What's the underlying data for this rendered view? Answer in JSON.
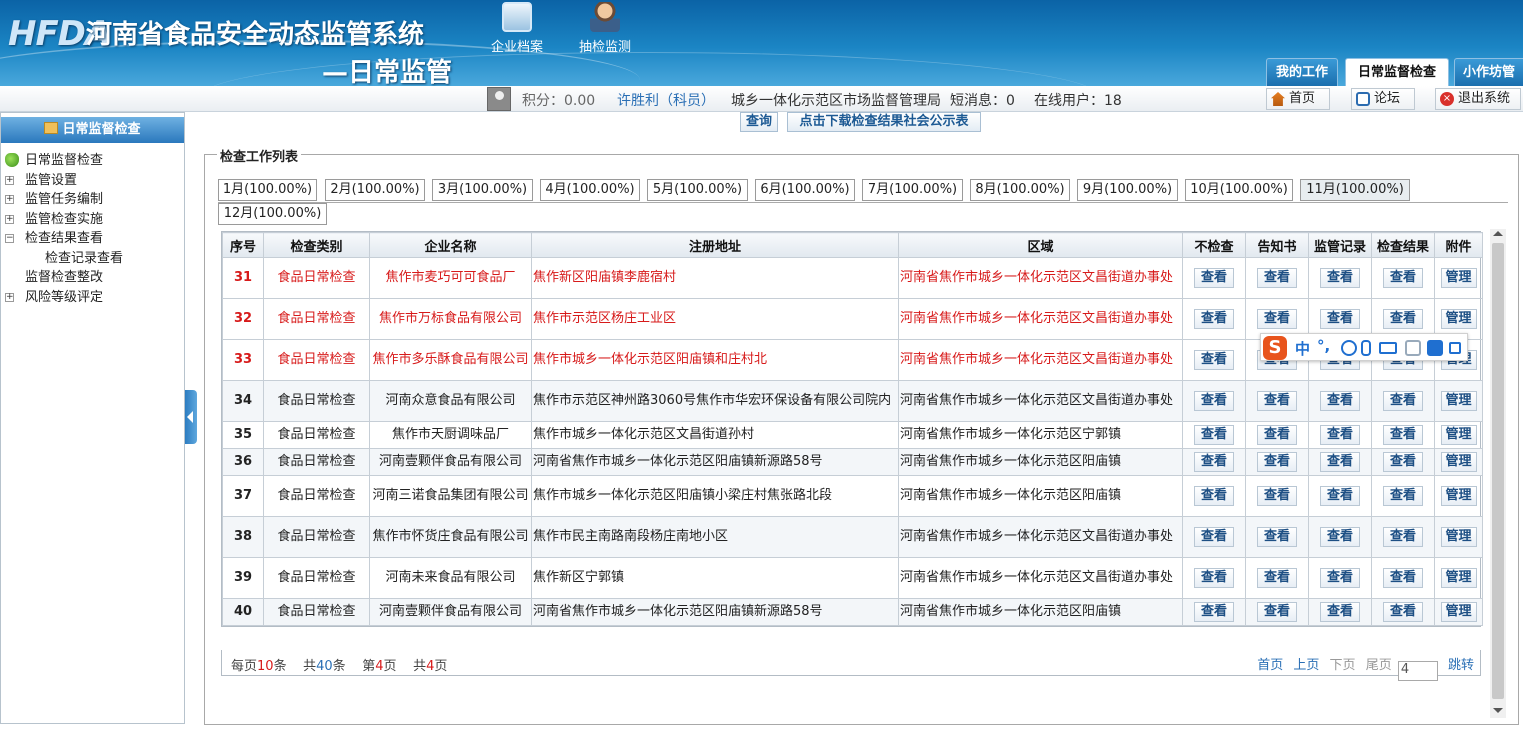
{
  "header": {
    "logo": "HFDA",
    "title_line1": "河南省食品安全动态监管系统",
    "title_line2": "—日常监管",
    "nav": [
      {
        "label": "企业档案"
      },
      {
        "label": "抽检监测"
      }
    ],
    "tabs": [
      "我的工作",
      "日常监督检查",
      "小作坊管理"
    ]
  },
  "infobar": {
    "score": "积分：0.00",
    "user": "许胜利（科员）",
    "org": "城乡一体化示范区市场监督管理局",
    "messages": "短消息：0",
    "online": "在线用户：18",
    "buttons": [
      "首页",
      "论坛",
      "退出系统"
    ]
  },
  "sidebar": {
    "title": "日常监督检查",
    "items": [
      {
        "label": "日常监督检查",
        "icon": "tree-root-icon"
      },
      {
        "label": "监管设置",
        "toggle": "+"
      },
      {
        "label": "监管任务编制",
        "toggle": "+"
      },
      {
        "label": "监管检查实施",
        "toggle": "+"
      },
      {
        "label": "检查结果查看",
        "toggle": "−"
      },
      {
        "label": "检查记录查看",
        "child": true
      },
      {
        "label": "监督检查整改",
        "leaf": true
      },
      {
        "label": "风险等级评定",
        "toggle": "+"
      }
    ]
  },
  "toolbar": {
    "query": "查询",
    "download": "点击下载检查结果社会公示表"
  },
  "panel": {
    "legend": "检查工作列表",
    "months": [
      "1月(100.00%)",
      "2月(100.00%)",
      "3月(100.00%)",
      "4月(100.00%)",
      "5月(100.00%)",
      "6月(100.00%)",
      "7月(100.00%)",
      "8月(100.00%)",
      "9月(100.00%)",
      "10月(100.00%)",
      "11月(100.00%)",
      "12月(100.00%)"
    ],
    "active_month": "11月(100.00%)"
  },
  "table": {
    "columns": [
      "序号",
      "检查类别",
      "企业名称",
      "注册地址",
      "区域",
      "不检查",
      "告知书",
      "监管记录",
      "检查结果",
      "附件"
    ],
    "rows": [
      {
        "seq": "31",
        "type": "食品日常检查",
        "company": "焦作市麦巧可可食品厂",
        "address": "焦作新区阳庙镇李鹿宿村",
        "region": "河南省焦作市城乡一体化示范区文昌街道办事处",
        "highlight": true
      },
      {
        "seq": "32",
        "type": "食品日常检查",
        "company": "焦作市万标食品有限公司",
        "address": "焦作市示范区杨庄工业区",
        "region": "河南省焦作市城乡一体化示范区文昌街道办事处",
        "highlight": true
      },
      {
        "seq": "33",
        "type": "食品日常检查",
        "company": "焦作市多乐酥食品有限公司",
        "address": "焦作市城乡一体化示范区阳庙镇和庄村北",
        "region": "河南省焦作市城乡一体化示范区文昌街道办事处",
        "highlight": true
      },
      {
        "seq": "34",
        "type": "食品日常检查",
        "company": "河南众意食品有限公司",
        "address": "焦作市示范区神州路3060号焦作市华宏环保设备有限公司院内",
        "region": "河南省焦作市城乡一体化示范区文昌街道办事处",
        "highlight": false
      },
      {
        "seq": "35",
        "type": "食品日常检查",
        "company": "焦作市天厨调味品厂",
        "address": "焦作市城乡一体化示范区文昌街道孙村",
        "region": "河南省焦作市城乡一体化示范区宁郭镇",
        "highlight": false
      },
      {
        "seq": "36",
        "type": "食品日常检查",
        "company": "河南壹颗伴食品有限公司",
        "address": "河南省焦作市城乡一体化示范区阳庙镇新源路58号",
        "region": "河南省焦作市城乡一体化示范区阳庙镇",
        "highlight": false
      },
      {
        "seq": "37",
        "type": "食品日常检查",
        "company": "河南三诺食品集团有限公司",
        "address": "焦作市城乡一体化示范区阳庙镇小梁庄村焦张路北段",
        "region": "河南省焦作市城乡一体化示范区阳庙镇",
        "highlight": false
      },
      {
        "seq": "38",
        "type": "食品日常检查",
        "company": "焦作市怀货庄食品有限公司",
        "address": "焦作市民主南路南段杨庄南地小区",
        "region": "河南省焦作市城乡一体化示范区文昌街道办事处",
        "highlight": false
      },
      {
        "seq": "39",
        "type": "食品日常检查",
        "company": "河南未来食品有限公司",
        "address": "焦作新区宁郭镇",
        "region": "河南省焦作市城乡一体化示范区文昌街道办事处",
        "highlight": false
      },
      {
        "seq": "40",
        "type": "食品日常检查",
        "company": "河南壹颗伴食品有限公司",
        "address": "河南省焦作市城乡一体化示范区阳庙镇新源路58号",
        "region": "河南省焦作市城乡一体化示范区阳庙镇",
        "highlight": false
      }
    ],
    "action_view": "查看",
    "action_manage": "管理"
  },
  "pager": {
    "per_page_pre": "每页",
    "per_page": "10",
    "per_page_suf": "条",
    "total_pre": "共",
    "total": "40",
    "total_suf": "条",
    "current_pre": "第",
    "current": "4",
    "current_suf": "页",
    "pages_pre": "共",
    "pages": "4",
    "pages_suf": "页",
    "first": "首页",
    "prev": "上页",
    "next": "下页",
    "last": "尾页",
    "jump_value": "4",
    "jump": "跳转"
  },
  "ime": {
    "label": "中",
    "extra": "°,"
  }
}
